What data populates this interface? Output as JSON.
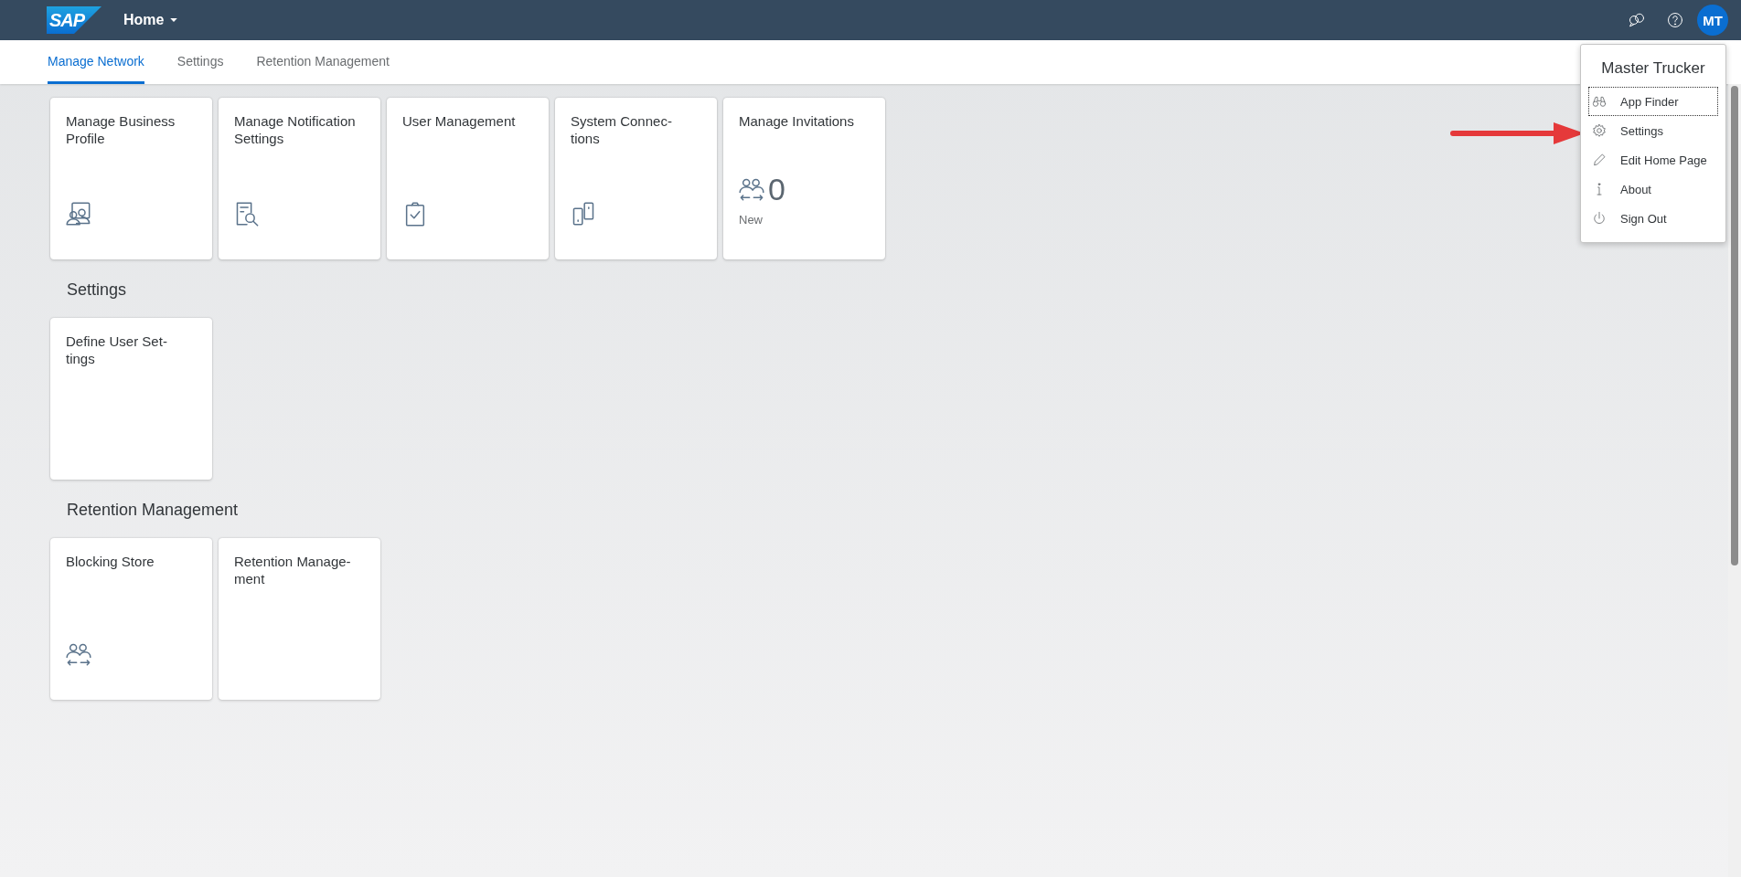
{
  "shell_bar": {
    "logo": "SAP",
    "title": "Home",
    "avatar": "MT"
  },
  "tabs": [
    {
      "label": "Manage Network",
      "selected": true
    },
    {
      "label": "Settings",
      "selected": false
    },
    {
      "label": "Retention Management",
      "selected": false
    }
  ],
  "sections": [
    {
      "tiles": [
        {
          "title": "Manage Business\nProfile",
          "kind": "profile"
        },
        {
          "title": "Manage Notification\nSettings",
          "kind": "notification"
        },
        {
          "title": "User Management",
          "kind": "clipboard"
        },
        {
          "title": "System Connec-\ntions",
          "kind": "devices"
        },
        {
          "title": "Manage Invitations",
          "kind": "counter",
          "count": "0",
          "footer": "New"
        }
      ]
    },
    {
      "title": "Settings",
      "tiles": [
        {
          "title": "Define User Set-\ntings",
          "kind": "plain"
        }
      ]
    },
    {
      "title": "Retention Management",
      "tiles": [
        {
          "title": "Blocking Store",
          "kind": "exchange"
        },
        {
          "title": "Retention Manage-\nment",
          "kind": "plain"
        }
      ]
    }
  ],
  "user_menu": {
    "name": "Master Trucker",
    "items": [
      {
        "label": "App Finder",
        "kind": "binoculars",
        "focused": true
      },
      {
        "label": "Settings",
        "kind": "gear",
        "focused": false
      },
      {
        "label": "Edit Home Page",
        "kind": "pencil",
        "focused": false
      },
      {
        "label": "About",
        "kind": "info",
        "focused": false
      },
      {
        "label": "Sign Out",
        "kind": "power",
        "focused": false
      }
    ]
  }
}
